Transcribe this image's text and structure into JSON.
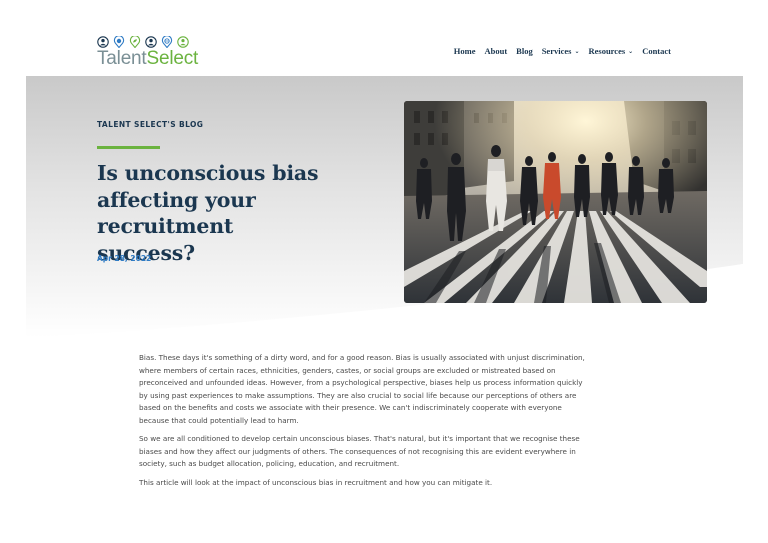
{
  "logo": {
    "text_primary": "Talent",
    "text_accent": "Select",
    "icons": [
      {
        "name": "person-icon",
        "color": "#1b3750"
      },
      {
        "name": "globe-pin-icon",
        "color": "#2f7bc4"
      },
      {
        "name": "leaf-pin-icon",
        "color": "#6bb33f"
      },
      {
        "name": "person-icon",
        "color": "#1b3750"
      },
      {
        "name": "globe-pin-icon",
        "color": "#2f7bc4"
      },
      {
        "name": "person-pin-icon",
        "color": "#6bb33f"
      }
    ]
  },
  "nav": {
    "items": [
      {
        "label": "Home"
      },
      {
        "label": "About"
      },
      {
        "label": "Blog"
      },
      {
        "label": "Services",
        "dropdown": true
      },
      {
        "label": "Resources",
        "dropdown": true
      },
      {
        "label": "Contact"
      }
    ],
    "chevron": "⌄"
  },
  "hero": {
    "eyebrow": "TALENT SELECT'S BLOG",
    "title": "Is unconscious bias affecting your recruitment success?",
    "date": "Apr 28, 2022",
    "image_subject": "crowd-crossing-street-photo"
  },
  "article": {
    "paragraphs": [
      "Bias. These days it's something of a dirty word, and for a good reason. Bias is usually associated with unjust discrimination, where members of certain races, ethnicities, genders, castes, or social groups are excluded or mistreated based on preconceived and unfounded ideas. However, from a psychological perspective, biases help us process information quickly by using past experiences to make assumptions. They are also crucial to social life because our perceptions of others are based on the benefits and costs we associate with their presence. We can't indiscriminately cooperate with everyone because that could potentially lead to harm.",
      "So we are all conditioned to develop certain unconscious biases. That's natural, but it's important that we recognise these biases and how they affect our judgments of others. The consequences of not recognising this are evident everywhere in society, such as budget allocation, policing, education, and recruitment.",
      "This article will look at the impact of unconscious bias in recruitment and how you can mitigate it."
    ]
  },
  "colors": {
    "navy": "#1b3750",
    "green": "#6bb33f",
    "blue": "#2f7bc4",
    "hero_gray": "#cfcfcf"
  }
}
